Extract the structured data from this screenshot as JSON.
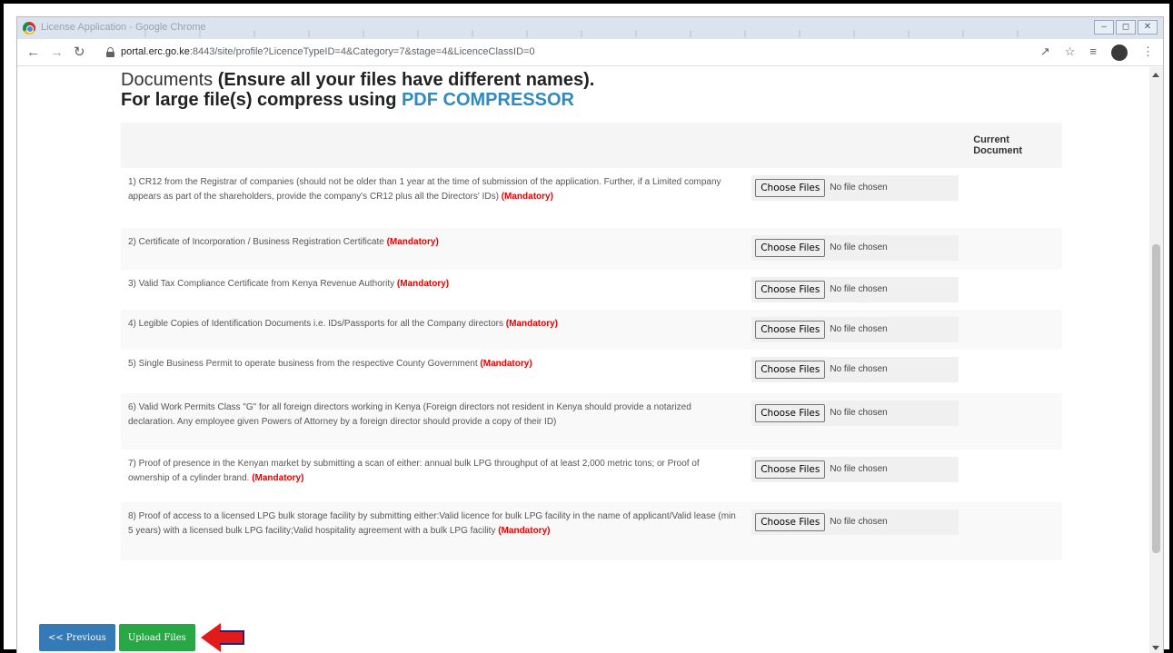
{
  "window": {
    "title": "License Application - Google Chrome"
  },
  "addressbar": {
    "host": "portal.erc.go.ke",
    "path": ":8443/site/profile?LicenceTypeID=4&Category=7&stage=4&LicenceClassID=0"
  },
  "heading": {
    "line1_light": "Documents ",
    "line1_bold": "(Ensure all your files have different names).",
    "line2_bold": "For large file(s) compress using ",
    "line2_link": "PDF COMPRESSOR"
  },
  "table": {
    "header_current": "Current Document",
    "mandatory_label": "(Mandatory)",
    "choose_label": "Choose Files",
    "nofile_label": "No file chosen",
    "rows": [
      {
        "text": "1) CR12 from the Registrar of companies (should not be older than 1 year at the time of submission of the application. Further, if a Limited company appears as part of the shareholders, provide the company's CR12 plus all the Directors' IDs)",
        "mandatory": "(Mandatory)"
      },
      {
        "text": "2) Certificate of Incorporation / Business Registration Certificate",
        "mandatory": "(Mandatory)"
      },
      {
        "text": "3) Valid Tax Compliance Certificate from Kenya Revenue Authority",
        "mandatory": "(Mandatory)"
      },
      {
        "text": "4) Legible Copies of Identification Documents i.e. IDs/Passports for all the Company directors",
        "mandatory": "(Mandatory)"
      },
      {
        "text": "5) Single Business Permit to operate business from the respective County Government",
        "mandatory": "(Mandatory)"
      },
      {
        "text": "6) Valid Work Permits Class \"G\" for all foreign directors working in Kenya (Foreign directors not resident in Kenya should provide a notarized declaration. Any employee given Powers of Attorney by a foreign director should provide a copy of their ID)",
        "mandatory": ""
      },
      {
        "text": "7) Proof of presence in the Kenyan market by submitting a scan of either: annual bulk LPG throughput of at least 2,000 metric tons; or Proof of ownership of a cylinder brand.",
        "mandatory": "(Mandatory)"
      },
      {
        "text": "8) Proof of access to a licensed LPG bulk storage facility by submitting either:Valid licence for bulk LPG facility in the name of applicant/Valid lease (min 5 years) with a licensed bulk LPG facility;Valid hospitality agreement with a bulk LPG facility",
        "mandatory": "(Mandatory)"
      }
    ]
  },
  "buttons": {
    "previous": "<< Previous",
    "upload": "Upload Files"
  }
}
